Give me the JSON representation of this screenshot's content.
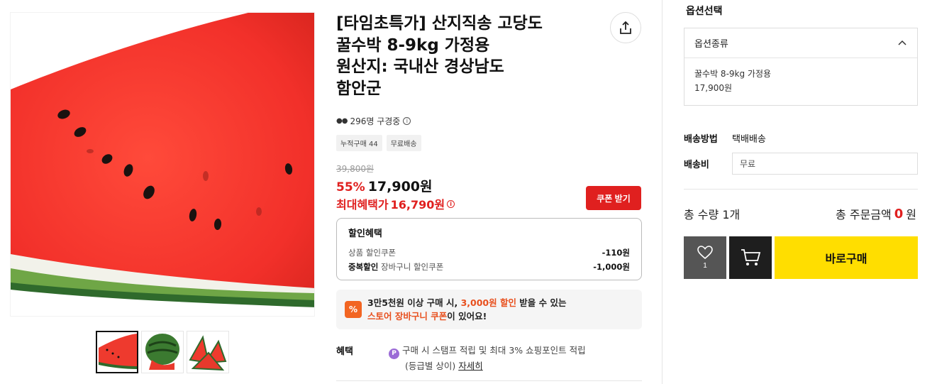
{
  "product": {
    "title_lines": [
      "[타임초특가] 산지직송 고당도",
      "꿀수박 8-9kg 가정용",
      "원산지: 국내산 경상남도",
      "함안군"
    ],
    "viewers_text": "296명 구경중",
    "tags": [
      "누적구매 44",
      "무료배송"
    ],
    "original_price": "39,800원",
    "discount_rate": "55%",
    "price": "17,900원",
    "max_benefit_label": "최대혜택가",
    "max_benefit_price": "16,790원",
    "coupon_button": "쿠폰 받기"
  },
  "discount_box": {
    "title": "할인혜택",
    "rows": [
      {
        "prefix": "",
        "label": "상품 할인쿠폰",
        "amount": "-110원"
      },
      {
        "prefix": "중복할인",
        "label": "장바구니 할인쿠폰",
        "amount": "-1,000원"
      }
    ]
  },
  "promo": {
    "icon": "%",
    "line1_a": "3만5천원 이상 구매 시, ",
    "line1_red": "3,000원 할인",
    "line1_b": " 받을 수 있는",
    "line2_red": "스토어 장바구니 쿠폰",
    "line2_b": "이 있어요!"
  },
  "benefit": {
    "label": "혜택",
    "p_icon": "P",
    "line1": "구매 시 스탬프 적립 및 최대 3% 쇼핑포인트 적립",
    "line2_a": "(등급별 상이) ",
    "detail_link": "자세히"
  },
  "options": {
    "section_title": "옵션선택",
    "dropdown_label": "옵션종류",
    "item_name": "꿀수박 8-9kg 가정용",
    "item_price": "17,900원"
  },
  "shipping": {
    "method_label": "배송방법",
    "method_value": "택배배송",
    "fee_label": "배송비",
    "fee_value": "무료"
  },
  "summary": {
    "total_qty": "총 수량 1개",
    "total_label": "총 주문금액",
    "total_value": "0",
    "total_unit": "원"
  },
  "actions": {
    "like_count": "1",
    "buy_label": "바로구매"
  },
  "colors": {
    "accent_red": "#e0201f",
    "buy_yellow": "#ffde00",
    "promo_orange": "#f26522"
  },
  "icons": {
    "share": "share-icon",
    "heart": "heart-icon",
    "cart": "cart-icon",
    "chevron": "chevron-up-icon"
  }
}
